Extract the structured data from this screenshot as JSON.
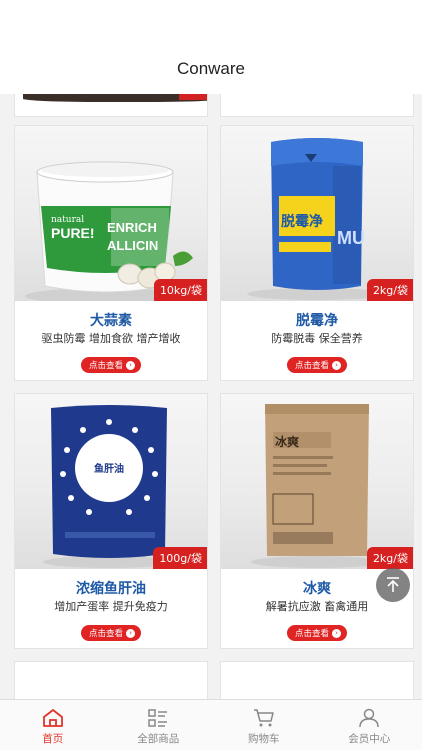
{
  "navbar": {
    "title": "Conware"
  },
  "products": [
    {
      "name": "大蒜素",
      "desc": "驱虫防霉  增加食欲  增产增收",
      "weight": "10kg/袋",
      "button": "点击查看",
      "label_lines": [
        "natural",
        "PURE!",
        "ENRICH",
        "ALLICIN"
      ]
    },
    {
      "name": "脱霉净",
      "desc": "防霉脱毒  保全营养",
      "weight": "2kg/袋",
      "button": "点击查看",
      "label_lines": [
        "脱霉净",
        "MU"
      ]
    },
    {
      "name": "浓缩鱼肝油",
      "desc": "增加产蛋率  提升免疫力",
      "weight": "100g/袋",
      "button": "点击查看",
      "label_lines": [
        "鱼肝油"
      ]
    },
    {
      "name": "冰爽",
      "desc": "解暑抗应激  畜禽通用",
      "weight": "2kg/袋",
      "button": "点击查看",
      "label_lines": [
        "冰爽"
      ]
    }
  ],
  "tabs": [
    {
      "label": "首页",
      "icon": "home-icon",
      "active": true
    },
    {
      "label": "全部商品",
      "icon": "list-icon",
      "active": false
    },
    {
      "label": "购物车",
      "icon": "cart-icon",
      "active": false
    },
    {
      "label": "会员中心",
      "icon": "user-icon",
      "active": false
    }
  ],
  "colors": {
    "accent": "#e0342a",
    "button": "#e02424",
    "product_name": "#1f5aa6",
    "weight_tag": "#d72020"
  }
}
